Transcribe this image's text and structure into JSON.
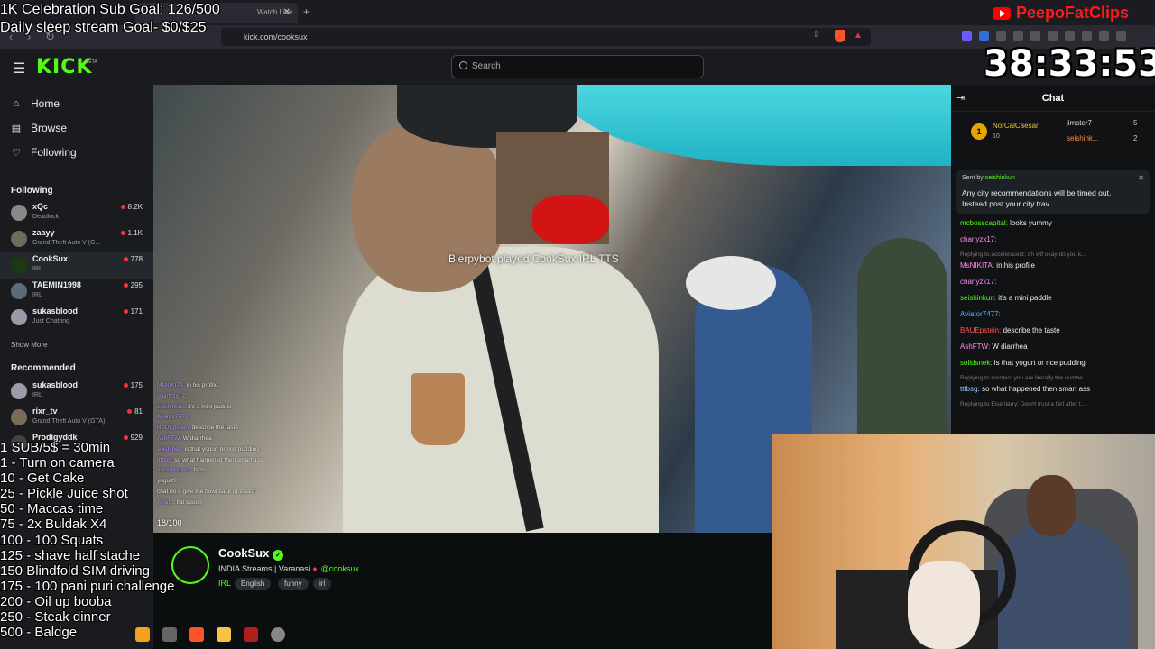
{
  "browser": {
    "tab_title": "Watch Live",
    "url": "kick.com/cooksux"
  },
  "header": {
    "logo": "KICK",
    "logo_badge": "BETA",
    "search_placeholder": "Search"
  },
  "sidebar": {
    "nav": [
      {
        "label": "Home",
        "icon": "home-icon"
      },
      {
        "label": "Browse",
        "icon": "browse-icon"
      },
      {
        "label": "Following",
        "icon": "heart-icon"
      }
    ],
    "following_title": "Following",
    "following": [
      {
        "name": "xQc",
        "game": "Deadlock",
        "viewers": "8.2K"
      },
      {
        "name": "zaayy",
        "game": "Grand Theft Auto V (G...",
        "viewers": "1.1K"
      },
      {
        "name": "CookSux",
        "game": "IRL",
        "viewers": "778"
      },
      {
        "name": "TAEMIN1998",
        "game": "IRL",
        "viewers": "295"
      },
      {
        "name": "sukasblood",
        "game": "Just Chatting",
        "viewers": "171"
      }
    ],
    "show_more": "Show More",
    "recommended_title": "Recommended",
    "recommended": [
      {
        "name": "sukasblood",
        "game": "IRL",
        "viewers": "175"
      },
      {
        "name": "rixr_tv",
        "game": "Grand Theft Auto V (GTA)",
        "viewers": "81"
      },
      {
        "name": "Prodigyddk",
        "game": "",
        "viewers": "929"
      }
    ]
  },
  "video": {
    "tts": "Blerpybot played CookSux IRL TTS",
    "chat_overlay": [
      {
        "user": "MsNIKITA:",
        "text": " in his profile"
      },
      {
        "user": "charlyzx17:",
        "text": ""
      },
      {
        "user": "seishinkun:",
        "text": " it's a mini paddle"
      },
      {
        "user": "Aviator7477:",
        "text": ""
      },
      {
        "user": "BAUEpstein:",
        "text": " describe the taste"
      },
      {
        "user": "AshFTW:",
        "text": " W diarrhea"
      },
      {
        "user": "solidsnek:",
        "text": " is that yogurt or rice pudding"
      },
      {
        "user": "tttbsg:",
        "text": " so what happened then smart ass"
      },
      {
        "user": "acceleracerz:",
        "text": " facts"
      },
      {
        "user": "",
        "text": " yogurt?"
      },
      {
        "user": "",
        "text": " chat do u give the bowl back or toss it?"
      },
      {
        "user": "Aviat...",
        "text": " flat spoon"
      }
    ],
    "viewer_overlay": "18/100"
  },
  "channel": {
    "name": "CookSux",
    "title": "INDIA Streams | Varanasi",
    "handle": "@cooksux",
    "category": "IRL",
    "tags": [
      "English",
      "funny",
      "irl"
    ]
  },
  "chat": {
    "title": "Chat",
    "leaderboard": [
      {
        "rank": "1",
        "name": "NorCalCaesar",
        "value": "10"
      },
      {
        "name": "jimster7",
        "value": "5"
      },
      {
        "name": "seishink...",
        "value": "2"
      }
    ],
    "pinned": {
      "sent_by": "Sent by",
      "user": "seishinkun",
      "text": "Any city recommendations will be timed out. Instead post your city trav..."
    },
    "messages": [
      {
        "user": "mcbosscapital:",
        "text": " looks yummy",
        "cls": "u1"
      },
      {
        "user": "charlyzx17:",
        "text": "",
        "cls": "u2"
      },
      {
        "reply": "Replying to acceleracerz: oh wtf okay do you k..."
      },
      {
        "user": "MsNIKITA:",
        "text": " in his profile",
        "cls": "u2"
      },
      {
        "user": "charlyzx17:",
        "text": "",
        "cls": "u2"
      },
      {
        "user": "seishinkun:",
        "text": " it's a mini paddle",
        "cls": "u1"
      },
      {
        "user": "Aviator7477:",
        "text": "",
        "cls": "u3"
      },
      {
        "user": "BAUEpstein:",
        "text": " describe the taste",
        "cls": "u4"
      },
      {
        "user": "AshFTW:",
        "text": " W diarrhea",
        "cls": "u2"
      },
      {
        "user": "solidsnek:",
        "text": " is that yogurt or rice pudding",
        "cls": "u1"
      },
      {
        "reply": "Replying to mortein: you are literally the dumbe..."
      },
      {
        "user": "tttbsg:",
        "text": " so what happened then smart ass",
        "cls": "u6"
      },
      {
        "reply": "Replying to Eisenlarry: Don#t trust a fart after t..."
      }
    ]
  },
  "overlay": {
    "goal1": "1K Celebration Sub Goal: 126/500",
    "goal2": "Daily sleep stream Goal- $0/$25",
    "timer": "38:33:53",
    "brand": "PeepoFatClips",
    "sub_menu": [
      "1 SUB/5$ = 30min",
      "1 - Turn on camera",
      "10 - Get Cake",
      "25 - Pickle Juice shot",
      "50 - Maccas time",
      "75 - 2x Buldak X4",
      "100 - 100 Squats",
      "125 - shave half stache",
      "150 Blindfold SIM driving",
      "175 - 100 pani puri challenge",
      "200 - Oil up booba",
      "250 - Steak dinner",
      "500 - Baldge"
    ]
  },
  "colors": {
    "kick_green": "#53fc18",
    "live_red": "#f5333f",
    "brand_red": "#ff1a1a"
  }
}
